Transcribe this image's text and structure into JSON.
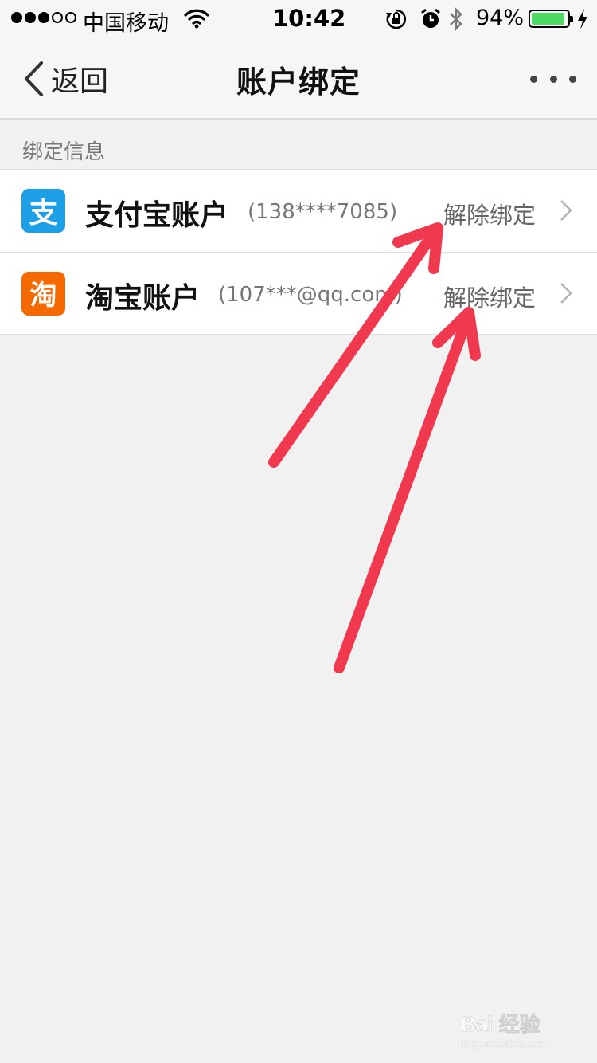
{
  "status_bar": {
    "carrier": "中国移动",
    "time": "10:42",
    "battery": "94%",
    "battery_level": 0.94,
    "signal_bars": 3,
    "signal_total": 5
  },
  "nav": {
    "back_label": "返回",
    "title": "账户绑定"
  },
  "section": {
    "header": "绑定信息",
    "rows": [
      {
        "name": "支付宝账户",
        "account": "(138****7085)",
        "action": "解除绑定",
        "icon": "alipay-icon",
        "icon_glyph": "支",
        "icon_color": "#1c9fe4"
      },
      {
        "name": "淘宝账户",
        "account": "(107***@qq.com)",
        "action": "解除绑定",
        "icon": "taobao-icon",
        "icon_glyph": "淘",
        "icon_color": "#f56a00"
      }
    ]
  },
  "annotation": {
    "arrow_color": "#f0394e",
    "arrow_count": 2
  },
  "watermark": {
    "text": "Bai 经验",
    "url_text": "jingyan.baidu.com"
  },
  "colors": {
    "background": "#f2f1f2",
    "battery_fill": "#4cd964"
  }
}
